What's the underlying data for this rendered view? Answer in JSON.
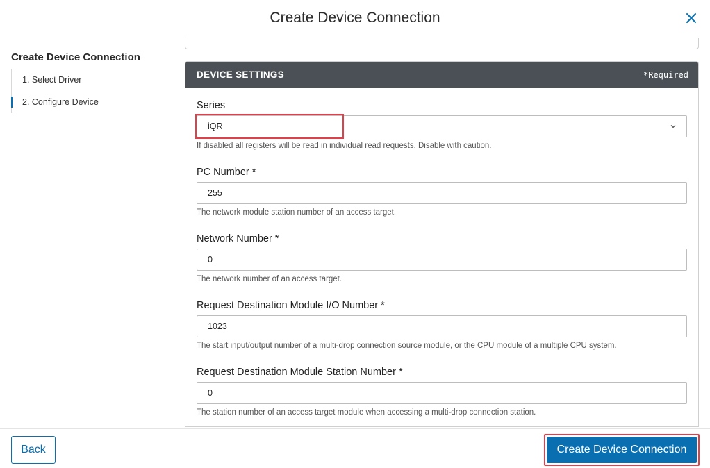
{
  "dialog": {
    "title": "Create Device Connection",
    "close_icon": "close-icon"
  },
  "sidebar": {
    "title": "Create Device Connection",
    "steps": [
      {
        "label": "1. Select Driver",
        "active": false
      },
      {
        "label": "2. Configure Device",
        "active": true
      }
    ]
  },
  "panel": {
    "title": "DEVICE SETTINGS",
    "required_note": "*Required"
  },
  "fields": [
    {
      "label": "Series",
      "value": "iQR",
      "type": "select",
      "help": "If disabled all registers will be read in individual read requests. Disable with caution."
    },
    {
      "label": "PC Number *",
      "value": "255",
      "type": "text",
      "help": "The network module station number of an access target."
    },
    {
      "label": "Network Number *",
      "value": "0",
      "type": "text",
      "help": "The network number of an access target."
    },
    {
      "label": "Request Destination Module I/O Number *",
      "value": "1023",
      "type": "text",
      "help": "The start input/output number of a multi-drop connection source module, or the CPU module of a multiple CPU system."
    },
    {
      "label": "Request Destination Module Station Number *",
      "value": "0",
      "type": "text",
      "help": "The station number of an access target module when accessing a multi-drop connection station."
    }
  ],
  "footer": {
    "back_label": "Back",
    "create_label": "Create Device Connection"
  },
  "colors": {
    "accent": "#0a6fb0",
    "panel_header": "#4a5055",
    "highlight": "#e0404a"
  }
}
